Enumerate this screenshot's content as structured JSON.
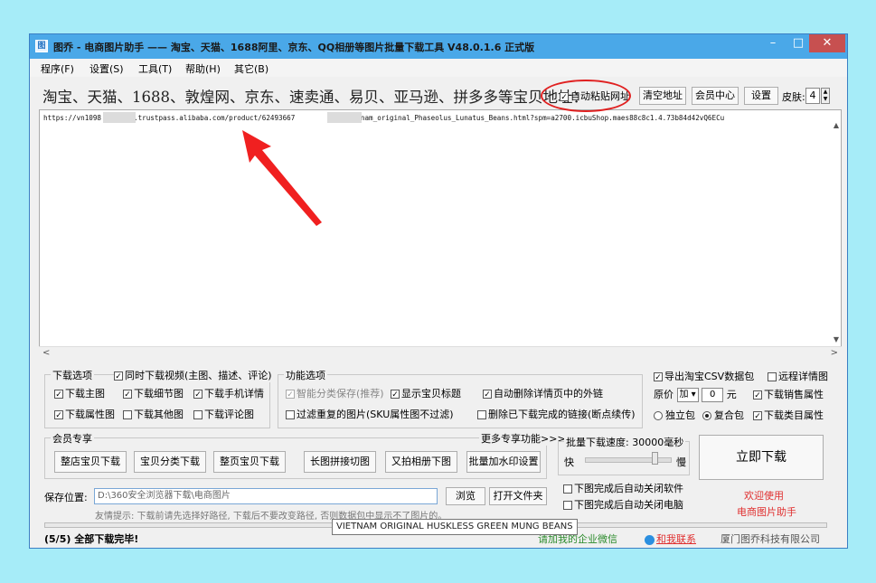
{
  "window": {
    "app_icon": "app-logo-icon",
    "title": "图乔 - 电商图片助手 —— 淘宝、天猫、1688阿里、京东、QQ相册等图片批量下载工具 V48.0.1.6 正式版",
    "minimize": "–",
    "maximize": "□",
    "close": "✕"
  },
  "menu": [
    "程序(F)",
    "设置(S)",
    "工具(T)",
    "帮助(H)",
    "其它(B)"
  ],
  "headline": "淘宝、天猫、1688、敦煌网、京东、速卖通、易贝、亚马逊、拼多多等宝贝地址：",
  "top_controls": {
    "auto_paste": {
      "label": "自动粘贴网址",
      "checked": true
    },
    "clear_btn": "清空地址",
    "member_btn": "会员中心",
    "settings_btn": "设置",
    "skin_label": "皮肤:",
    "skin_value": "4"
  },
  "url_area": {
    "line_part1": "https://vn1098",
    "line_part2": ".trustpass.alibaba.com/product/62493667",
    "line_part3": "775/Vietnam_original_Phaseolus_Lunatus_Beans.html?spm=a2700.icbuShop.maes88c8c1.4.73b84d42vQ6ECu"
  },
  "download_options": {
    "title": "下载选项",
    "video": {
      "label": "同时下载视频(主图、描述、评论)",
      "checked": true
    },
    "items": [
      {
        "label": "下载主图",
        "checked": true
      },
      {
        "label": "下载细节图",
        "checked": true
      },
      {
        "label": "下载手机详情",
        "checked": true
      },
      {
        "label": "下载属性图",
        "checked": true
      },
      {
        "label": "下载其他图",
        "checked": false
      },
      {
        "label": "下载评论图",
        "checked": false
      }
    ]
  },
  "function_options": {
    "title": "功能选项",
    "items": [
      {
        "label": "智能分类保存(推荐)",
        "checked": true,
        "disabled": true
      },
      {
        "label": "显示宝贝标题",
        "checked": true
      },
      {
        "label": "自动删除详情页中的外链",
        "checked": true
      },
      {
        "label": "过滤重复的图片(SKU属性图不过滤)",
        "checked": false
      },
      {
        "label": "删除已下载完成的链接(断点续传)",
        "checked": false
      }
    ]
  },
  "right_options": {
    "export_csv": {
      "label": "导出淘宝CSV数据包",
      "checked": true
    },
    "remote_detail": {
      "label": "远程详情图",
      "checked": false
    },
    "price_label": "原价",
    "price_op": "加",
    "price_value": "0",
    "price_unit": "元",
    "sales_attr": {
      "label": "下载销售属性",
      "checked": true
    },
    "standalone": {
      "label": "独立包",
      "selected": false
    },
    "combined": {
      "label": "复合包",
      "selected": true
    },
    "category_attr": {
      "label": "下载类目属性",
      "checked": true
    }
  },
  "member": {
    "title": "会员专享",
    "more": "更多专享功能>>>",
    "buttons": [
      "整店宝贝下载",
      "宝贝分类下载",
      "整页宝贝下载",
      "长图拼接切图",
      "又拍相册下图",
      "批量加水印设置"
    ]
  },
  "speed": {
    "title": "批量下载速度: 30000毫秒",
    "fast": "快",
    "slow": "慢",
    "value_fraction": 0.85
  },
  "after_options": [
    {
      "label": "下图完成后自动关闭软件",
      "checked": false
    },
    {
      "label": "下图完成后自动关闭电脑",
      "checked": false
    }
  ],
  "download_btn": "立即下载",
  "welcome": {
    "line1": "欢迎使用",
    "line2": "电商图片助手"
  },
  "save": {
    "label": "保存位置:",
    "path": "D:\\360安全浏览器下载\\电商图片",
    "browse": "浏览",
    "open_folder": "打开文件夹",
    "hint": "友情提示: 下载前请先选择好路径, 下载后不要改变路径, 否则数据包中显示不了图片的。"
  },
  "tooltip": "VIETNAM ORIGINAL HUSKLESS GREEN MUNG BEANS",
  "status": {
    "message": "(5/5) 全部下载完毕!",
    "wechat": "请加我的企业微信",
    "contact": "和我联系",
    "company": "厦门图乔科技有限公司"
  }
}
